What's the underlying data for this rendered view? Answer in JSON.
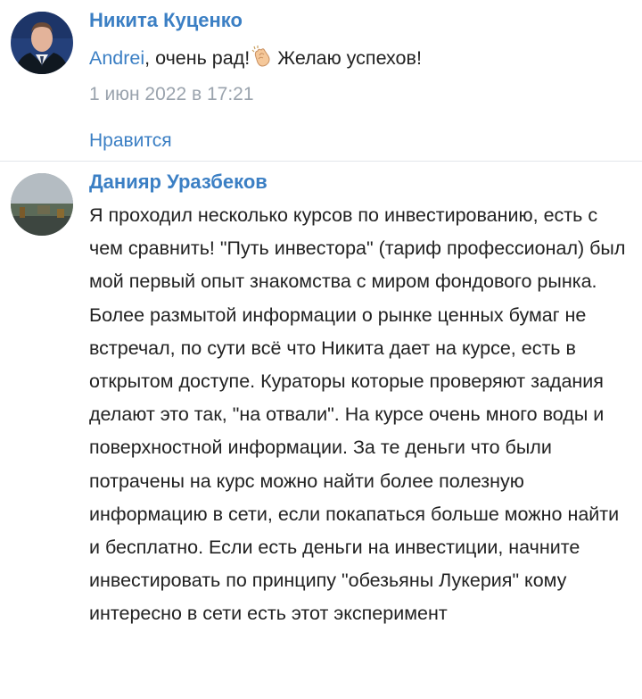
{
  "comments": [
    {
      "author": "Никита Куценко",
      "mention": "Andrei",
      "text_before_emoji": ", очень рад!",
      "emoji": "clapping-hands",
      "text_after_emoji": "Желаю успехов!",
      "date": "1 июн 2022 в 17:21",
      "like_label": "Нравится"
    },
    {
      "author": "Данияр Уразбеков",
      "text": "Я проходил несколько курсов по инвестированию, есть с чем сравнить! \"Путь инвестора\" (тариф профессионал) был мой первый опыт знакомства с миром фондового рынка. Более размытой информации о рынке ценных бумаг не встречал, по сути всё что Никита дает на курсе, есть в открытом доступе. Кураторы которые проверяют задания делают это так, \"на отвали\". На курсе очень много воды и поверхностной информации. За те деньги что были потрачены на курс можно найти более полезную информацию в сети, если покапаться больше можно найти и бесплатно. Если есть деньги на инвестиции, начните инвестировать по принципу \"обезьяны Лукерия\" кому интересно в сети есть этот эксперимент"
    }
  ],
  "colors": {
    "link": "#3b7fc4",
    "muted": "#9aa3ad",
    "divider": "#e3e6ea"
  }
}
